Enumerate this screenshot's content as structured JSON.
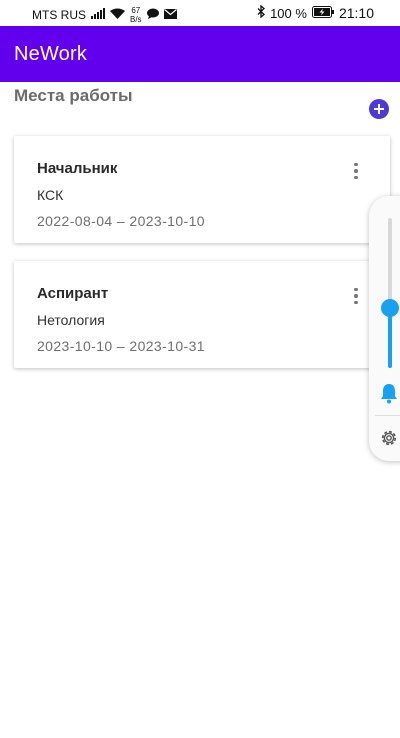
{
  "status_bar": {
    "carrier": "MTS RUS",
    "speed_value": "67",
    "speed_unit": "B/s",
    "battery_percent": "100 %",
    "time": "21:10"
  },
  "app_bar": {
    "title": "NeWork"
  },
  "section": {
    "title": "Места работы"
  },
  "jobs": [
    {
      "position": "Начальник",
      "company": "КСК",
      "dates": "2022-08-04  –  2023-10-10"
    },
    {
      "position": "Аспирант",
      "company": "Нетология",
      "dates": "2023-10-10  –  2023-10-31"
    }
  ],
  "volume": {
    "level": 0.4,
    "accent": "#1aa0f0"
  },
  "colors": {
    "app_bar": "#6200ee",
    "fab": "#4a3bd8"
  }
}
